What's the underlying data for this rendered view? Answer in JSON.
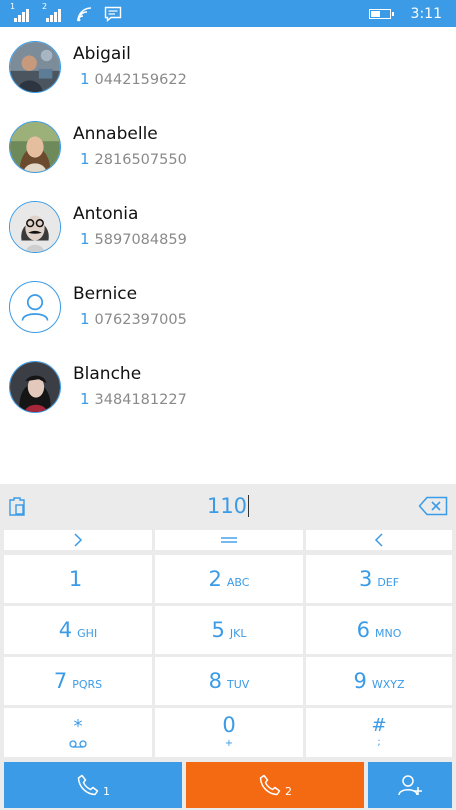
{
  "status_bar": {
    "sim1_label": "1",
    "sim2_label": "2",
    "time": "3:11",
    "icons": [
      "signal-icon",
      "signal-icon",
      "wifi-icon",
      "message-icon",
      "battery-icon"
    ]
  },
  "contacts": [
    {
      "name": "Abigail",
      "sim": "1",
      "number": "0442159622",
      "avatar": "photo"
    },
    {
      "name": "Annabelle",
      "sim": "1",
      "number": "2816507550",
      "avatar": "photo"
    },
    {
      "name": "Antonia",
      "sim": "1",
      "number": "5897084859",
      "avatar": "photo"
    },
    {
      "name": "Bernice",
      "sim": "1",
      "number": "0762397005",
      "avatar": "person-icon"
    },
    {
      "name": "Blanche",
      "sim": "1",
      "number": "3484181227",
      "avatar": "photo"
    }
  ],
  "dialer": {
    "input_value": "110",
    "nav": {
      "right": "›",
      "middle": "═",
      "left": "‹"
    },
    "keys": [
      {
        "digit": "1",
        "letters": ""
      },
      {
        "digit": "2",
        "letters": "ABC"
      },
      {
        "digit": "3",
        "letters": "DEF"
      },
      {
        "digit": "4",
        "letters": "GHI"
      },
      {
        "digit": "5",
        "letters": "JKL"
      },
      {
        "digit": "6",
        "letters": "MNO"
      },
      {
        "digit": "7",
        "letters": "PQRS"
      },
      {
        "digit": "8",
        "letters": "TUV"
      },
      {
        "digit": "9",
        "letters": "WXYZ"
      },
      {
        "digit": "*",
        "letters": "voicemail-icon"
      },
      {
        "digit": "0",
        "letters": "+"
      },
      {
        "digit": "#",
        "letters": ";"
      }
    ]
  },
  "actions": {
    "call_sim1_label": "1",
    "call_sim2_label": "2",
    "add_contact": "add-contact-icon"
  },
  "colors": {
    "accent": "#3b9be6",
    "call_sim2": "#f46a12",
    "panel_bg": "#ebebeb",
    "number_text": "#8a8a8a"
  }
}
